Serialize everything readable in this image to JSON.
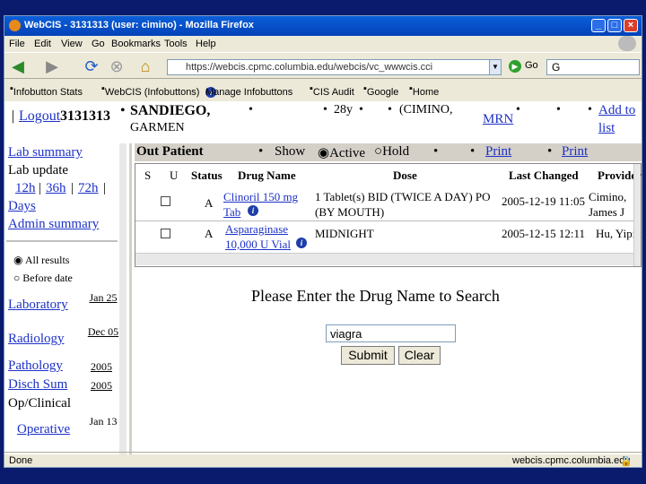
{
  "window": {
    "title": "WebCIS - 3131313 (user: cimino) - Mozilla Firefox"
  },
  "menu": [
    "File",
    "Edit",
    "View",
    "Go",
    "Bookmarks",
    "Tools",
    "Help"
  ],
  "address": {
    "url": "https://webcis.cpmc.columbia.edu/webcis/vc_wwwcis.cci",
    "go_label": "Go",
    "search_value": "G"
  },
  "bookmarks": [
    "Infobutton Stats",
    "WebCIS (Infobuttons)",
    "Manage Infobuttons",
    "CIS Audit",
    "Google",
    "Home"
  ],
  "patient": {
    "logout_label": "Logout",
    "mrn_id": "3131313",
    "name": "SANDIEGO,",
    "name_line2": "GARMEN",
    "age": "28y",
    "attending": "(CIMINO,",
    "mrn_label": "MRN",
    "add_to_label": "Add to",
    "add_to_line2": "list",
    "bullet": "•"
  },
  "sidebar": {
    "lab_summary": "Lab summary",
    "lab_update": "Lab update",
    "ranges": [
      "12h",
      "36h",
      "72h"
    ],
    "days": "Days",
    "admin_summary": "Admin summary",
    "radio_all": "All results",
    "radio_before": "Before date",
    "rows": [
      {
        "label": "Laboratory",
        "date": "Jan 25"
      },
      {
        "label": "Radiology",
        "date": "Dec 05"
      },
      {
        "label": "Pathology",
        "date": "2005"
      },
      {
        "label": "Disch Sum",
        "date": "2005"
      },
      {
        "label": "Op/Clinical",
        "date": ""
      },
      {
        "label": "Operative",
        "date": "Jan 13"
      }
    ]
  },
  "meds": {
    "section": "Out Patient",
    "show": "Show",
    "active": "Active",
    "hold": "Hold",
    "print": "Print",
    "headers": [
      "S",
      "U",
      "Status",
      "Drug Name",
      "Dose",
      "Last Changed",
      "Provider"
    ],
    "rows": [
      {
        "status": "A",
        "drug": "Clinoril 150 mg Tab",
        "dose": "1 Tablet(s) BID (TWICE A DAY) PO (BY MOUTH)",
        "changed": "2005-12-19 11:05",
        "provider": "Cimino, James J"
      },
      {
        "status": "A",
        "drug": "Asparaginase 10,000 U Vial",
        "dose": "MIDNIGHT",
        "changed": "2005-12-15 12:11",
        "provider": "Hu, Yiping"
      }
    ]
  },
  "search": {
    "heading": "Please Enter the Drug Name to Search",
    "value": "viagra",
    "submit": "Submit",
    "clear": "Clear"
  },
  "status": {
    "left": "Done",
    "right": "webcis.cpmc.columbia.edu"
  }
}
